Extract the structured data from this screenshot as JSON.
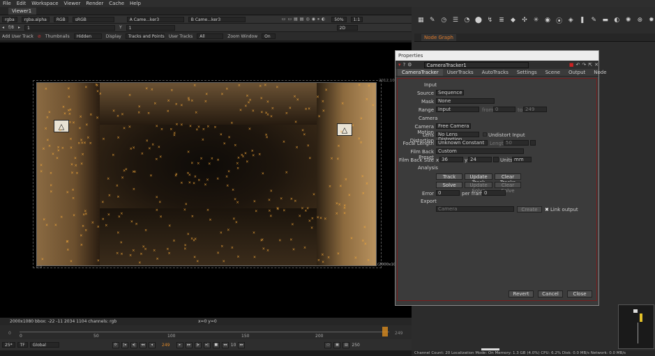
{
  "menu": [
    "File",
    "Edit",
    "Workspace",
    "Viewer",
    "Render",
    "Cache",
    "Help"
  ],
  "viewer_tab": "Viewer1",
  "viewer_bar1": {
    "channels": "rgba",
    "alpha": "rgba.alpha",
    "colorspace": "RGB",
    "lut": "sRGB",
    "input_a": "A  Came...ker3",
    "input_b": "B  Came...ker3",
    "zoom": "50%",
    "ratio": "1:1",
    "proxy": "2D"
  },
  "viewer_bar2": {
    "fstop": "f/8",
    "frame": "1",
    "y_label": "Y",
    "y_value": "1"
  },
  "tracker_bar": {
    "add_user_track": "Add User Track",
    "thumbnails_label": "Thumbnails",
    "thumbnails_value": "Hidden",
    "display_label": "Display",
    "display_value": "Tracks and Points",
    "user_tracks_label": "User Tracks",
    "user_tracks_value": "All",
    "zoom_window_label": "Zoom Window",
    "zoom_window_value": "On"
  },
  "format_label_top": "2012,10",
  "format_label_bottom": "(2000x1080",
  "format_label_origin": "0,0",
  "info_bar": {
    "format": "2000x1080  bbox: -22 -11 2034 1104 channels: rgb",
    "coords": "x=0 y=0"
  },
  "timeline": {
    "ticks": [
      "0",
      "50",
      "100",
      "150",
      "200"
    ],
    "end_marker": "249",
    "current": "249",
    "first": "0",
    "last": "249"
  },
  "transport": {
    "fps": "25*",
    "tf": "TF",
    "global": "Global",
    "current_frame": "249",
    "step": "10",
    "end_frame": "250"
  },
  "node_graph_tab": "Node Graph",
  "status": "Channel Count: 20  Localization Mode: On  Memory: 1.3 GB (4.0%)  CPU: 6.2%  Disk: 0.0 MB/s  Network: 0.0 MB/s",
  "properties": {
    "title": "Properties",
    "node_name": "CameraTracker1",
    "tabs": [
      "CameraTracker",
      "UserTracks",
      "AutoTracks",
      "Settings",
      "Scene",
      "Output",
      "Node"
    ],
    "input_section": "Input",
    "source_label": "Source",
    "source_value": "Sequence",
    "mask_label": "Mask",
    "mask_value": "None",
    "range_label": "Range",
    "range_value": "Input",
    "range_from_label": "from",
    "range_from": "0",
    "range_to_label": "to",
    "range_to": "249",
    "camera_section": "Camera",
    "camera_motion_label": "Camera Motion",
    "camera_motion_value": "Free Camera",
    "lens_distortion_label": "Lens Distortion",
    "lens_distortion_value": "No Lens Distortion",
    "undistort_label": "Undistort Input",
    "focal_length_label": "Focal Length",
    "focal_length_value": "Unknown Constant",
    "length_label": "Length",
    "length_value": "50",
    "film_back_preset_label": "Film Back Preset",
    "film_back_preset_value": "Custom",
    "film_back_size_label": "Film Back Size",
    "fb_x_label": "x",
    "fb_x": "36",
    "fb_y_label": "y",
    "fb_y": "24",
    "units_label": "Units",
    "units_value": "mm",
    "analysis_section": "Analysis",
    "track_btn": "Track",
    "update_track_btn": "Update Track",
    "clear_tracks_btn": "Clear Tracks",
    "solve_btn": "Solve",
    "update_solve_btn": "Update Solve",
    "clear_solve_btn": "Clear Solve",
    "error_label": "Error",
    "error_value": "0",
    "per_frame_label": "per frame",
    "per_frame_value": "0",
    "export_section": "Export",
    "export_value": "Camera",
    "create_btn": "Create",
    "link_output_label": "Link output",
    "revert_btn": "Revert",
    "cancel_btn": "Cancel",
    "close_btn": "Close"
  }
}
